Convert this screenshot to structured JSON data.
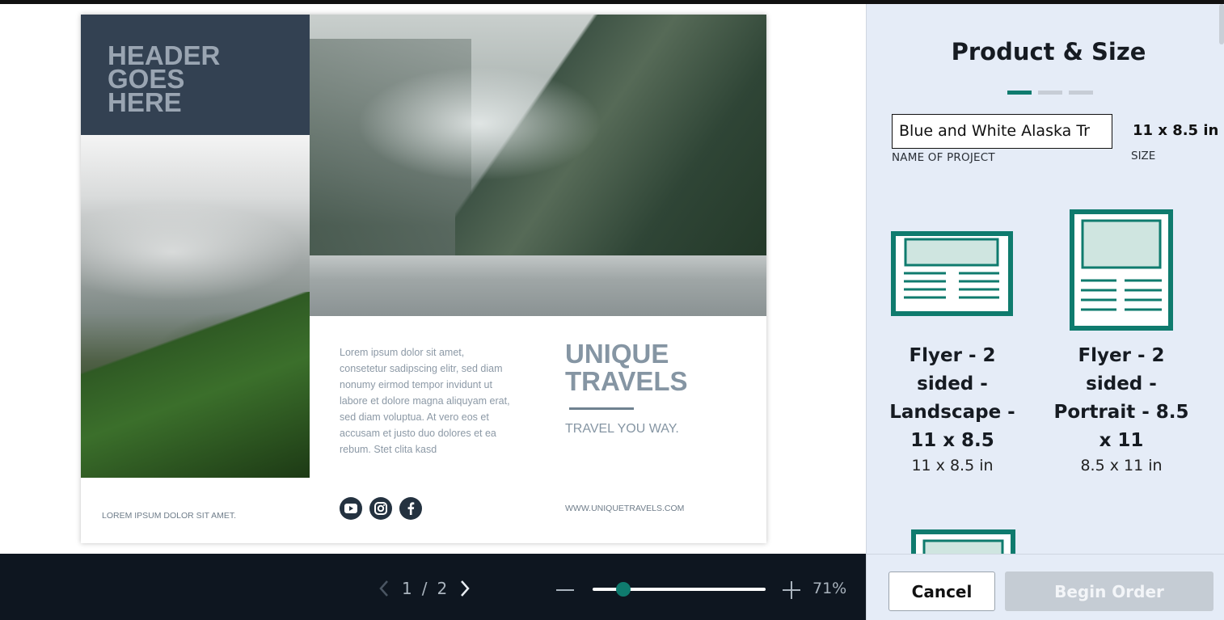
{
  "flyer": {
    "header": "HEADER\nGOES\nHERE",
    "body_text": "Lorem ipsum dolor sit amet, consetetur sadipscing elitr, sed diam nonumy eirmod tempor invidunt ut labore et dolore magna aliquyam erat, sed diam voluptua. At vero eos et accusam et justo duo dolores et ea rebum. Stet clita kasd",
    "headline": "UNIQUE\nTRAVELS",
    "tagline": "TRAVEL YOU WAY.",
    "footer_left": "LOREM IPSUM DOLOR SIT AMET.",
    "website": "WWW.UNIQUETRAVELS.COM",
    "social_icons": [
      "youtube-icon",
      "instagram-icon",
      "facebook-icon"
    ]
  },
  "pager": {
    "current": "1",
    "separator": "/",
    "total": "2"
  },
  "zoom": {
    "percent_label": "71%",
    "level": 0.71
  },
  "panel": {
    "title": "Product & Size",
    "steps_total": 3,
    "step_active": 1,
    "project_name_value": "Blue and White Alaska Tr",
    "project_name_label": "NAME OF PROJECT",
    "size_value": "11 x 8.5 in",
    "size_label": "SIZE",
    "products": [
      {
        "name": "Flyer - 2 sided - Landscape - 11 x 8.5",
        "size": "11 x 8.5 in"
      },
      {
        "name": "Flyer - 2 sided - Portrait - 8.5 x 11",
        "size": "8.5 x 11 in"
      }
    ]
  },
  "actions": {
    "cancel_label": "Cancel",
    "begin_label": "Begin Order"
  },
  "colors": {
    "accent": "#0f7b6e",
    "header_block": "#334152",
    "panel_bg": "#e5ecf7",
    "bottombar_bg": "#0e1620",
    "disabled_btn": "#c5ccd4"
  }
}
